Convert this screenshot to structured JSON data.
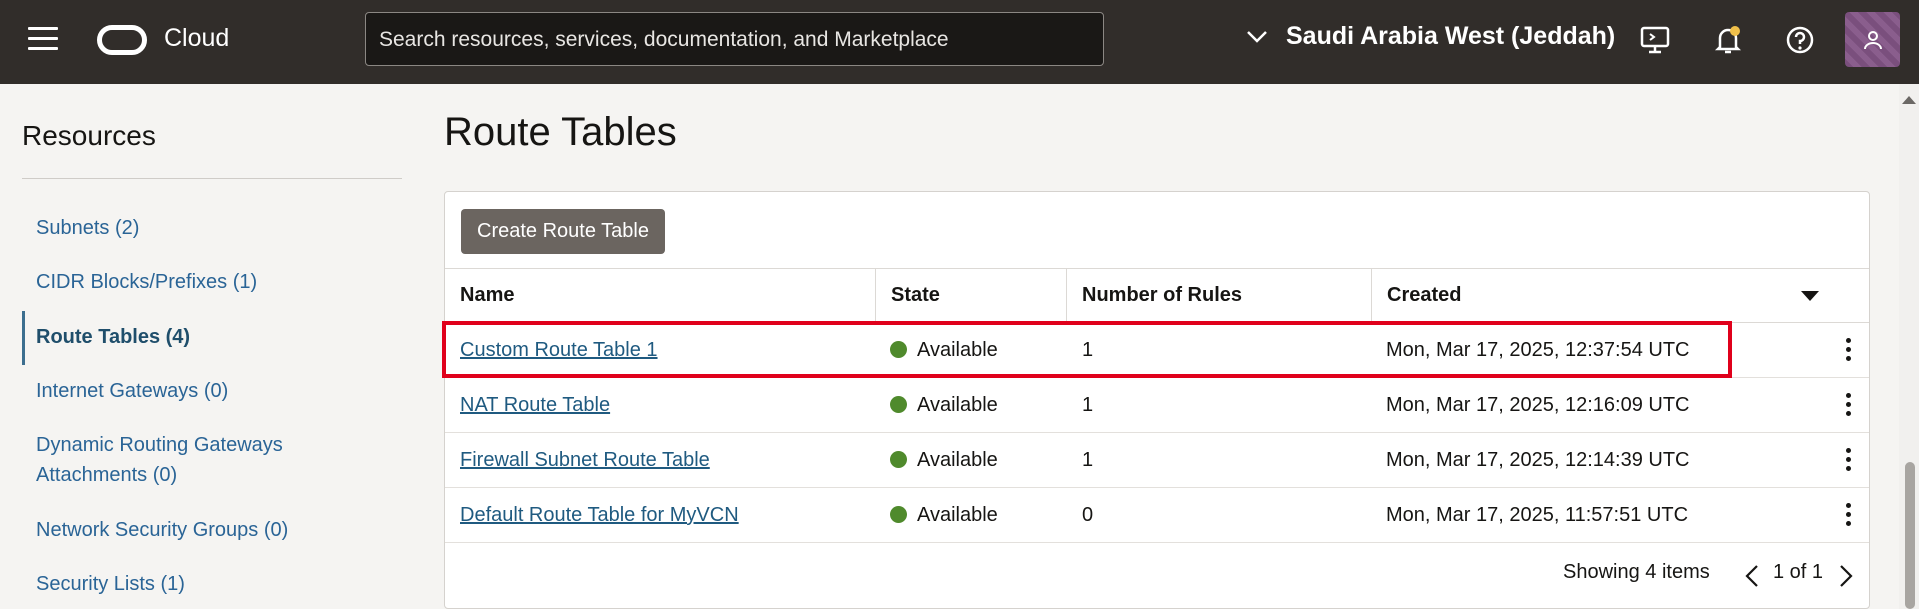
{
  "header": {
    "brand": "Cloud",
    "search_placeholder": "Search resources, services, documentation, and Marketplace",
    "region": "Saudi Arabia West (Jeddah)"
  },
  "sidebar": {
    "title": "Resources",
    "items": [
      {
        "label": "Subnets (2)"
      },
      {
        "label": "CIDR Blocks/Prefixes (1)"
      },
      {
        "label": "Route Tables (4)"
      },
      {
        "label": "Internet Gateways (0)"
      },
      {
        "label": "Dynamic Routing Gateways"
      },
      {
        "label": "Attachments (0)"
      },
      {
        "label": "Network Security Groups (0)"
      },
      {
        "label": "Security Lists (1)"
      }
    ]
  },
  "main": {
    "title": "Route Tables",
    "create_button": "Create Route Table",
    "columns": [
      "Name",
      "State",
      "Number of Rules",
      "Created"
    ],
    "rows": [
      {
        "name": "Custom Route Table 1",
        "state": "Available",
        "rules": "1",
        "created": "Mon, Mar 17, 2025, 12:37:54 UTC"
      },
      {
        "name": "NAT Route Table",
        "state": "Available",
        "rules": "1",
        "created": "Mon, Mar 17, 2025, 12:16:09 UTC"
      },
      {
        "name": "Firewall Subnet Route Table",
        "state": "Available",
        "rules": "1",
        "created": "Mon, Mar 17, 2025, 12:14:39 UTC"
      },
      {
        "name": "Default Route Table for MyVCN",
        "state": "Available",
        "rules": "0",
        "created": "Mon, Mar 17, 2025, 11:57:51 UTC"
      }
    ],
    "showing": "Showing 4 items",
    "page": "1 of 1"
  },
  "colors": {
    "header_bg": "#312d2a",
    "status_available": "#4f8a2c",
    "highlight": "#e0001b",
    "link": "#1f5a80"
  }
}
